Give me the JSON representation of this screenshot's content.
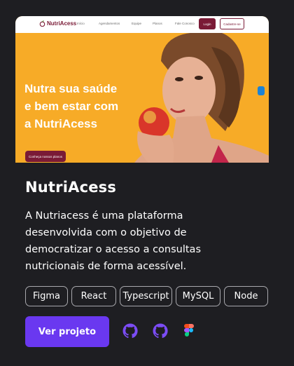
{
  "preview": {
    "logo_text": "NutriAcess",
    "nav_links": [
      "Início",
      "Agendamentos",
      "Equipe",
      "Planos",
      "Fale Conosco"
    ],
    "login_label": "Login",
    "signup_label": "Cadastre-se",
    "headline_lines": [
      "Nutra sua saúde",
      "e bem estar com",
      "a NutriAcess"
    ],
    "cta_label": "Conheça nossos planos",
    "colors": {
      "brand": "#7a1a36",
      "hero_bg": "#f7ab27"
    }
  },
  "card": {
    "title": "NutriAcess",
    "description_lines": [
      "A Nutriacess é uma plataforma",
      "desenvolvida com o objetivo de",
      "democratizar o acesso a consultas",
      "nutricionais de forma acessível."
    ],
    "tags": [
      "Figma",
      "React",
      "Typescript",
      "MySQL",
      "Node"
    ],
    "cta_label": "Ver projeto",
    "links": [
      {
        "icon": "github-icon",
        "color": "#7b4cf5"
      },
      {
        "icon": "github-icon",
        "color": "#7b4cf5"
      },
      {
        "icon": "figma-icon"
      }
    ],
    "colors": {
      "background": "#1e1e22",
      "accent": "#6a38f0",
      "tag_border": "#a8a8ad"
    }
  }
}
